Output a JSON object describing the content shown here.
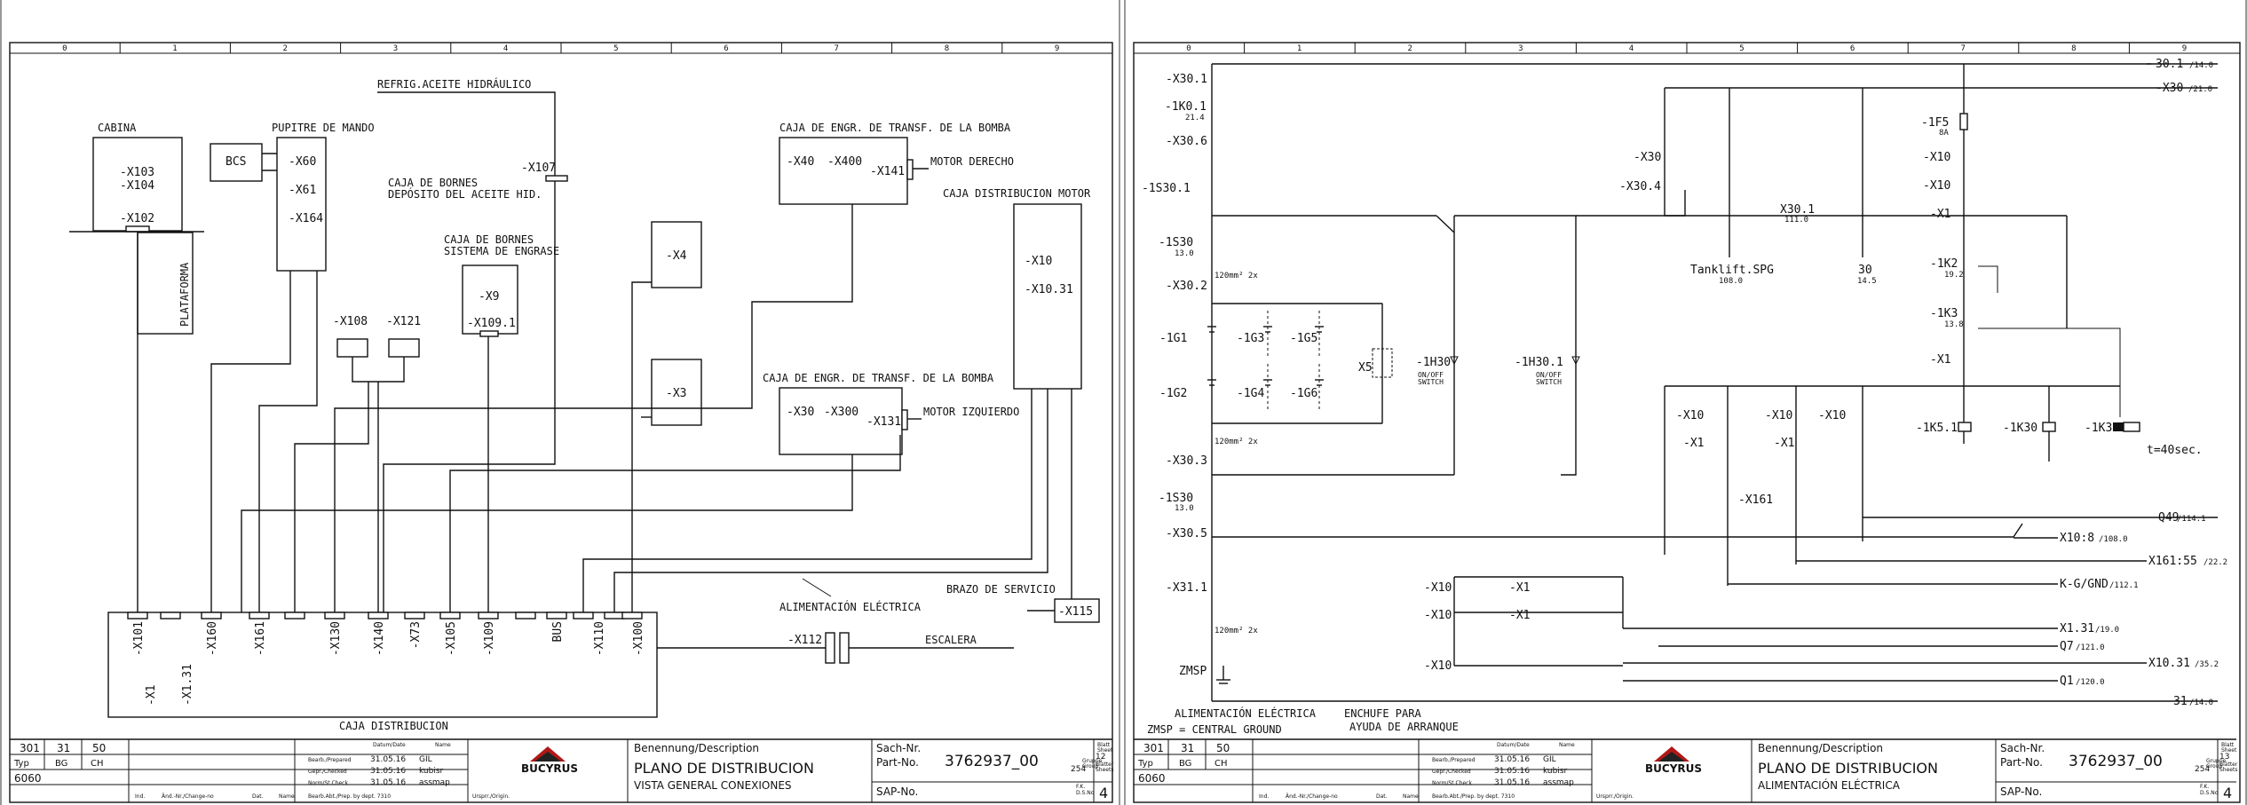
{
  "ruler_numbers": [
    "0",
    "1",
    "2",
    "3",
    "4",
    "5",
    "6",
    "7",
    "8",
    "9"
  ],
  "logo_text": "BUCYRUS",
  "left": {
    "labels": {
      "cabina": "CABINA",
      "x103": "-X103",
      "x104": "-X104",
      "x102": "-X102",
      "plataforma": "PLATAFORMA",
      "pupitre": "PUPITRE DE MANDO",
      "bcs": "BCS",
      "x60": "-X60",
      "x61": "-X61",
      "x164": "-X164",
      "refrig": "REFRIG.ACEITE HIDRÁULICO",
      "x107": "-X107",
      "cajabornes1": "CAJA DE BORNES",
      "cajabornes2": "DEPÓSITO DEL ACEITE HID.",
      "engrase1": "CAJA DE BORNES",
      "engrase2": "SISTEMA DE ENGRASE",
      "x9": "-X9",
      "x1091": "-X109.1",
      "x108": "-X108",
      "x121": "-X121",
      "x4": "-X4",
      "x3": "-X3",
      "engr1": "CAJA DE ENGR. DE TRANSF. DE LA BOMBA",
      "x40": "-X40",
      "x400": "-X400",
      "x141": "-X141",
      "motor_derecho": "MOTOR DERECHO",
      "caja_dist_motor": "CAJA DISTRIBUCION MOTOR",
      "x10": "-X10",
      "x1031": "-X10.31",
      "engr2": "CAJA DE ENGR. DE TRANSF. DE LA BOMBA",
      "x30": "-X30",
      "x300": "-X300",
      "x131": "-X131",
      "motor_izquierdo": "MOTOR IZQUIERDO",
      "brazo": "BRAZO DE SERVICIO",
      "x115": "-X115",
      "alimentacion": "ALIMENTACIÓN ELÉCTRICA",
      "x112": "-X112",
      "escalera": "ESCALERA",
      "caja_distribucion": "CAJA DISTRIBUCION",
      "xx1": "-X1",
      "xx131": "-X1.31"
    },
    "connectors": [
      "-X101",
      "-X160",
      "-X161",
      "-X130",
      "-X140",
      "-X73",
      "-X105",
      "-X109",
      "BUS",
      "-X110",
      "-X100"
    ]
  },
  "right": {
    "labels": {
      "t301": "30.1",
      "t301ref": "/14.0",
      "t3021": "-X30",
      "t3021ref": "/21.0",
      "x301": "-X30.1",
      "k101": "-1K0.1",
      "k101ref": "21.4",
      "x306": "-X30.6",
      "s301": "-1S30.1",
      "s30": "-1S30",
      "s30ref": "13.0",
      "x302": "-X30.2",
      "cable1": "120mm² 2x",
      "g1": "-1G1",
      "g2": "-1G2",
      "g3": "-1G3",
      "g4": "-1G4",
      "g5": "-1G5",
      "g6": "-1G6",
      "x5": "X5",
      "h30": "-1H30",
      "h301": "-1H30.1",
      "onoff": "ON/OFF",
      "switch": "SWITCH",
      "cable2": "120mm² 2x",
      "x303": "-X30.3",
      "s303": "-1S30",
      "s303ref": "13.0",
      "x305": "-X30.5",
      "x311": "-X31.1",
      "cable3": "120mm² 2x",
      "zmsp": "ZMSP",
      "x30b": "-X30",
      "x304": "-X30.4",
      "x301b": "X30.1",
      "x301bref": "111.0",
      "tanklift": "Tanklift.SPG",
      "tankliftref": "108.0",
      "n30": "30",
      "n30ref": "14.5",
      "f5": "-1F5",
      "f5a": "8A",
      "x1013": "-X10",
      "x10101": "-X10",
      "x1017": "-X1",
      "k2": "-1K2",
      "k2ref": "19.2",
      "k3a": "-1K3",
      "k3aref": "13.8",
      "x1019": "-X1",
      "x1012": "-X10",
      "x107": "-X10",
      "x108": "-X10",
      "x111": "-X1",
      "x118": "-X1",
      "k51": "-1K5.1",
      "k30": "-1K30",
      "k3": "-1K3",
      "t40": "t=40sec.",
      "x161": "-X161",
      "q49": "Q49",
      "q49ref": "/114.1",
      "x108b": "X10:8",
      "x108bref": "/108.0",
      "x16155": "X161:55",
      "x16155ref": "/22.2",
      "kg": "K-G/GND",
      "kgref": "/112.1",
      "x131": "X1.31",
      "x131ref": "/19.0",
      "q7": "Q7",
      "q7ref": "/121.0",
      "x1031": "X10.31",
      "x1031ref": "/35.2",
      "q1": "Q1",
      "q1ref": "/120.0",
      "n31": "31",
      "n31ref": "/14.0",
      "alim": "ALIMENTACIÓN ELÉCTRICA",
      "zmsp_ground": "ZMSP = CENTRAL GROUND",
      "enchufe1": "ENCHUFE PARA",
      "enchufe2": "AYUDA DE ARRANQUE",
      "x103": "-X10",
      "x104": "-X10",
      "x13": "-X1",
      "x14": "-X1",
      "x105": "-X10"
    }
  },
  "titleblock": {
    "left": {
      "n301": "301",
      "n31": "31",
      "n50": "50",
      "typ": "Typ",
      "bg": "BG",
      "ch": "CH",
      "n6060": "6060",
      "datum": "Datum/Date",
      "name": "Name",
      "prepared": "Bearb./Prepared",
      "checked": "Gepr./Checked",
      "normcheck": "Norm/St.Check",
      "d1": "31.05.16",
      "d2": "31.05.16",
      "d3": "31.05.16",
      "n1": "GIL",
      "n2": "kubisr",
      "n3": "assmap",
      "ind": "Ind.",
      "change": "Änd.-Nr./Change-no",
      "dat": "Dat.",
      "nm": "Name",
      "bearb": "Bearb.Abt./Prep. by dept. 7310",
      "orig": "Ursprr./Origin.",
      "benennung": "Benennung/Description",
      "desc1": "PLANO DE DISTRIBUCION",
      "desc2": "VISTA GENERAL CONEXIONES",
      "sach": "Sach-Nr.",
      "part": "Part-No.",
      "partno": "3762937_00",
      "sap": "SAP-No.",
      "blatt": "Blatt",
      "sheet": "Sheet",
      "sheetno": "12",
      "gruppe": "Gruppe",
      "group": "Group",
      "groupno": "254",
      "blaetter": "Blätter",
      "sheets": "Sheets",
      "fk": "F.K.",
      "ds": "D.S.No",
      "ver": "4"
    },
    "right": {
      "n301": "301",
      "n31": "31",
      "n50": "50",
      "typ": "Typ",
      "bg": "BG",
      "ch": "CH",
      "n6060": "6060",
      "datum": "Datum/Date",
      "name": "Name",
      "prepared": "Bearb./Prepared",
      "checked": "Gepr./Checked",
      "normcheck": "Norm/St.Check",
      "d1": "31.05.16",
      "d2": "31.05.16",
      "d3": "31.05.16",
      "n1": "GIL",
      "n2": "kubisr",
      "n3": "assmap",
      "ind": "Ind.",
      "change": "Änd.-Nr./Change-no",
      "dat": "Dat.",
      "nm": "Name",
      "bearb": "Bearb.Abt./Prep. by dept. 7310",
      "orig": "Ursprr./Origin.",
      "benennung": "Benennung/Description",
      "desc1": "PLANO DE DISTRIBUCION",
      "desc2": "ALIMENTACIÓN ELÉCTRICA",
      "sach": "Sach-Nr.",
      "part": "Part-No.",
      "partno": "3762937_00",
      "sap": "SAP-No.",
      "blatt": "Blatt",
      "sheet": "Sheet",
      "sheetno": "13",
      "gruppe": "Gruppe",
      "group": "Group",
      "groupno": "254",
      "blaetter": "Blätter",
      "sheets": "Sheets",
      "fk": "F.K.",
      "ds": "D.S.No",
      "ver": "4"
    }
  }
}
